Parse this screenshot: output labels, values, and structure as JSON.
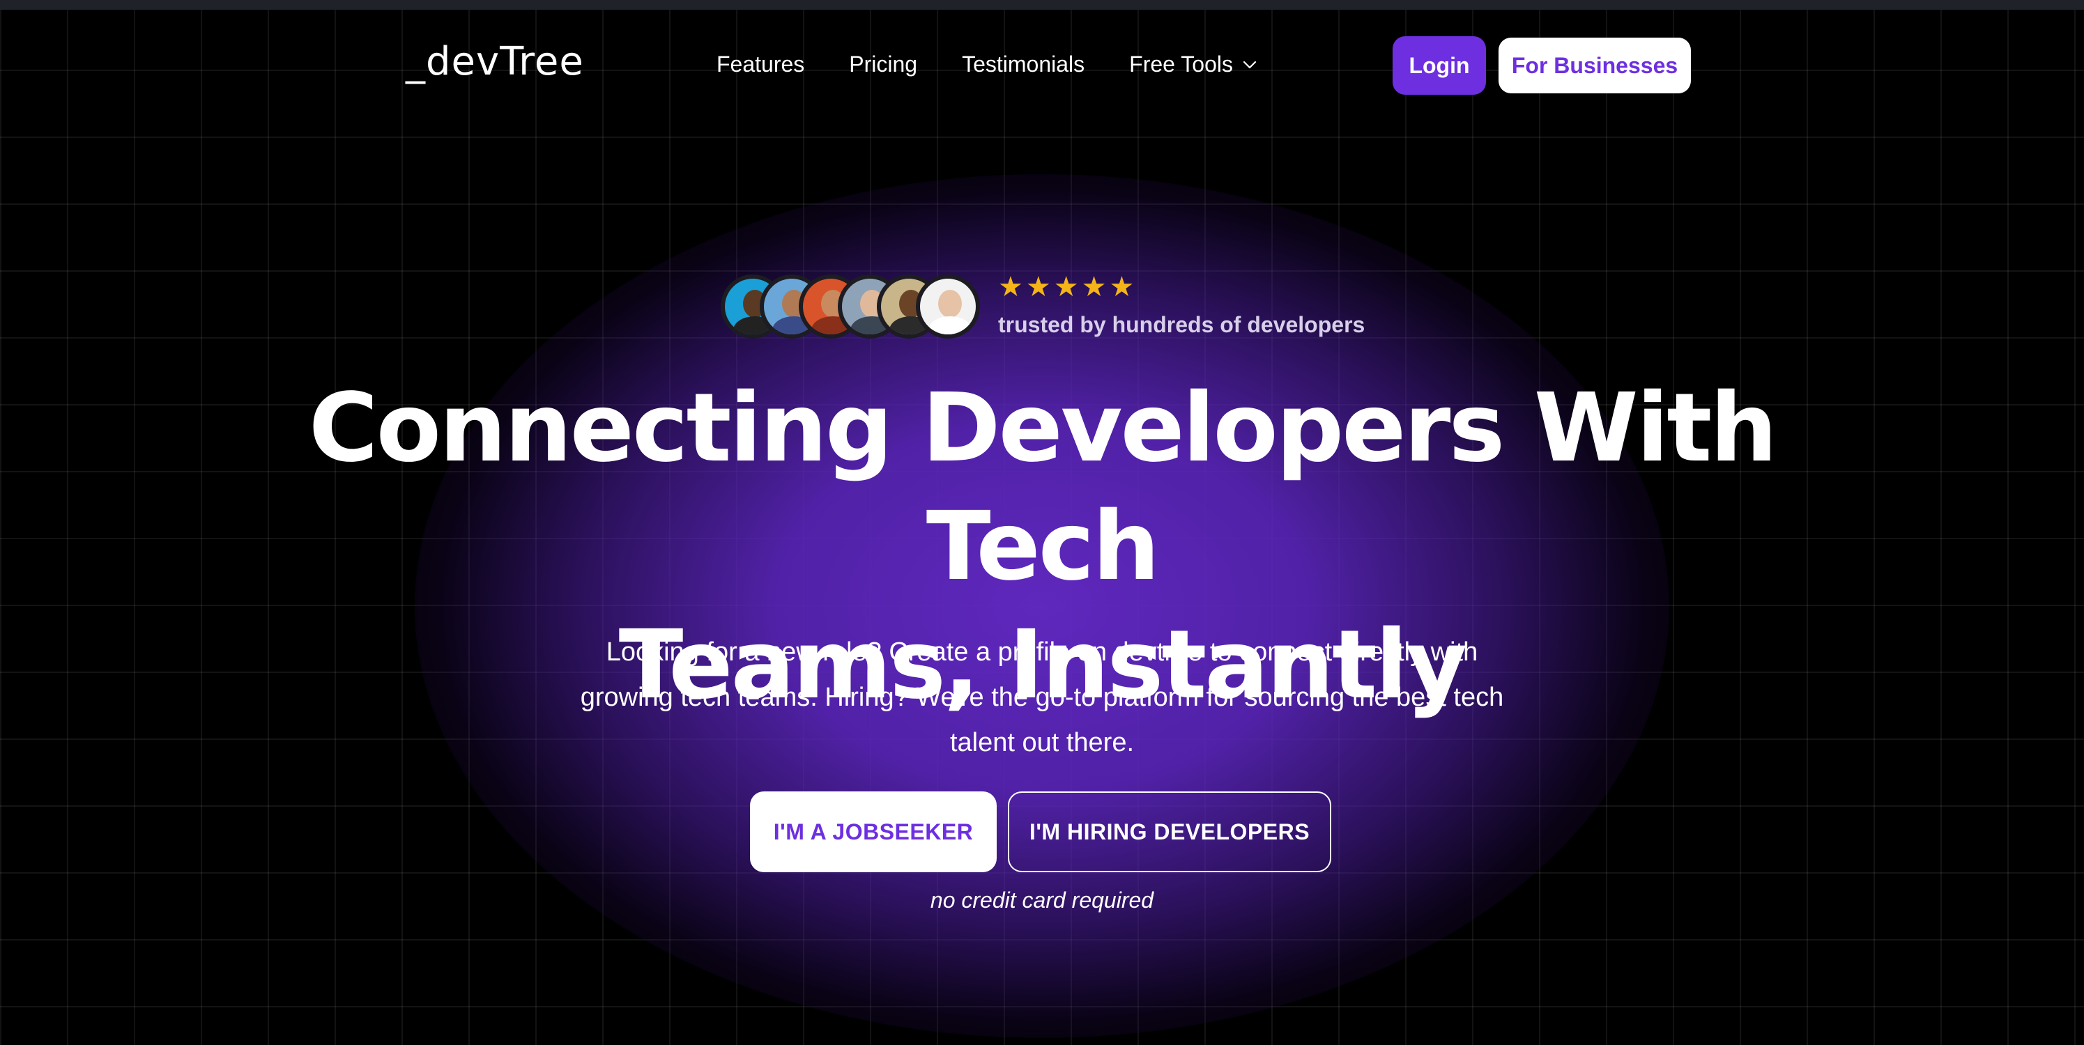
{
  "brand": {
    "logo": "_devTree"
  },
  "nav": {
    "links": [
      "Features",
      "Pricing",
      "Testimonials",
      "Free Tools"
    ],
    "login_label": "Login",
    "business_label": "For Businesses"
  },
  "trust": {
    "avatar_count": 6,
    "stars": 5,
    "text": "trusted by hundreds of developers"
  },
  "hero": {
    "headline_line1": "Connecting Developers With Tech",
    "headline_line2": "Teams, Instantly",
    "subtitle": "Looking for a new role? Create a profile on devtree to connect directly with growing tech teams. Hiring? We're the go-to platform for sourcing the best tech talent out there.",
    "cta_primary": "I'M A JOBSEEKER",
    "cta_secondary": "I'M HIRING DEVELOPERS",
    "note": "no credit card required"
  },
  "colors": {
    "accent": "#6d2fe0",
    "background": "#000000",
    "star": "#f5b518"
  }
}
